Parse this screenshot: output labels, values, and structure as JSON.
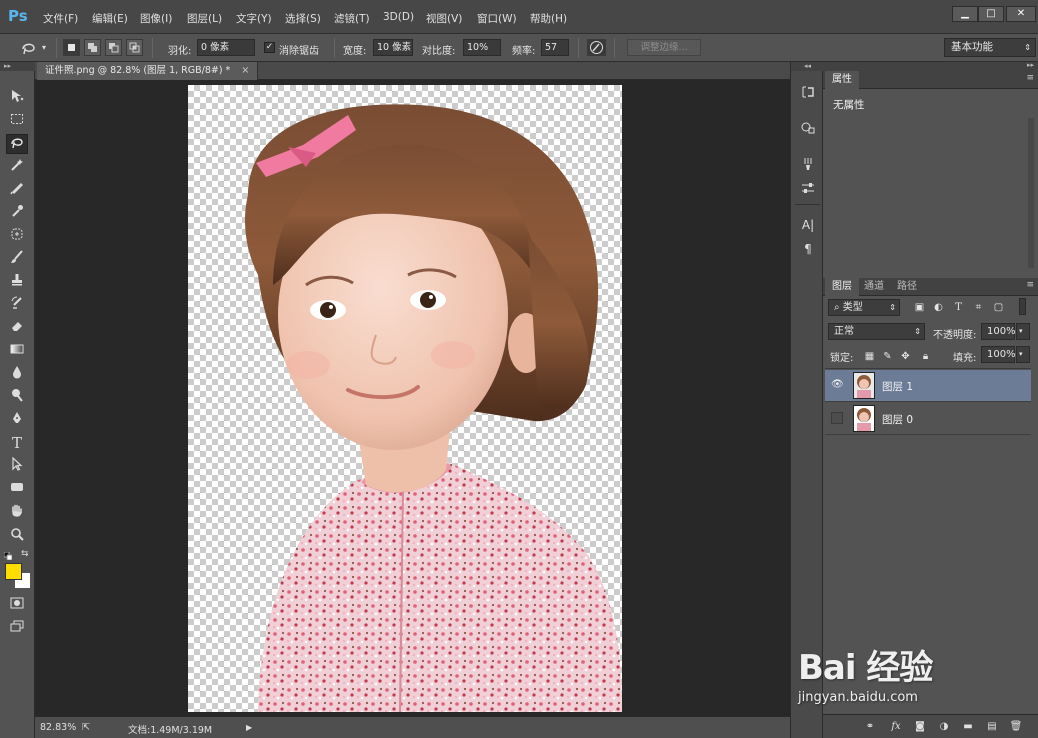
{
  "app": {
    "logo": "Ps",
    "accent": "#5ab4f0"
  },
  "menu": [
    "文件(F)",
    "编辑(E)",
    "图像(I)",
    "图层(L)",
    "文字(Y)",
    "选择(S)",
    "滤镜(T)",
    "3D(D)",
    "视图(V)",
    "窗口(W)",
    "帮助(H)"
  ],
  "window": {
    "minimize": "▁",
    "maximize": "□",
    "close": "✕"
  },
  "options": {
    "feather_label": "羽化:",
    "feather_value": "0 像素",
    "antialias_label": "消除锯齿",
    "antialias_checked": true,
    "width_label": "宽度:",
    "width_value": "10 像素",
    "contrast_label": "对比度:",
    "contrast_value": "10%",
    "frequency_label": "频率:",
    "frequency_value": "57",
    "refine_edge_label": "调整边缘...",
    "workspace": "基本功能"
  },
  "document": {
    "tab": "证件照.png @ 82.8% (图层 1, RGB/8#) *",
    "close": "×"
  },
  "status": {
    "zoom": "82.83%",
    "doc_size": "文档:1.49M/3.19M"
  },
  "colors": {
    "foreground": "#ffdd00",
    "background": "#ffffff",
    "selection": "#6c7b96"
  },
  "properties": {
    "tab": "属性",
    "content": "无属性"
  },
  "layers_panel": {
    "tabs": [
      "图层",
      "通道",
      "路径"
    ],
    "filter_kind": "类型",
    "blend_mode": "正常",
    "opacity_label": "不透明度:",
    "opacity_value": "100%",
    "lock_label": "锁定:",
    "fill_label": "填充:",
    "fill_value": "100%",
    "layers": [
      {
        "name": "图层 1",
        "visible": true,
        "selected": true
      },
      {
        "name": "图层 0",
        "visible": false,
        "selected": false
      }
    ]
  },
  "watermark": {
    "brand": "Bai 经验",
    "url": "jingyan.baidu.com"
  }
}
